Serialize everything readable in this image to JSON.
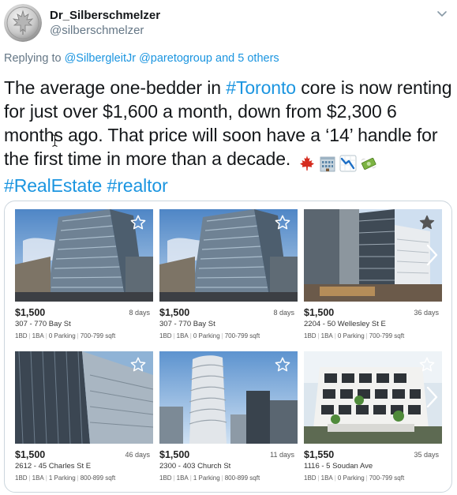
{
  "author": {
    "display_name": "Dr_Silberschmelzer",
    "handle": "@silberschmelzer"
  },
  "reply": {
    "prefix": "Replying to",
    "mentions": "@SilbergleitJr @paretogroup",
    "others": "and 5 others"
  },
  "tweet": {
    "text_1": "The average one-bedder in ",
    "hashtag_toronto": "#Toronto",
    "text_2": " core is now renting for just over $1,600 a month, down from $2,300 6 months ago. That price will soon have a ‘14’ handle for the first time in more than a decade. ",
    "hashtag_realestate": "#RealEstate",
    "hashtag_realtor": "#realtor",
    "emoji_icons": [
      "canada-flag-emoji",
      "office-building-emoji",
      "chart-decreasing-emoji",
      "money-with-wings-emoji"
    ]
  },
  "listings": [
    {
      "price": "$1,500",
      "days": "8 days",
      "address": "307 - 770 Bay St",
      "bd": "1BD",
      "ba": "1BA",
      "parking": "0 Parking",
      "sqft": "700-799 sqft"
    },
    {
      "price": "$1,500",
      "days": "8 days",
      "address": "307 - 770 Bay St",
      "bd": "1BD",
      "ba": "1BA",
      "parking": "0 Parking",
      "sqft": "700-799 sqft"
    },
    {
      "price": "$1,500",
      "days": "36 days",
      "address": "2204 - 50 Wellesley St E",
      "bd": "1BD",
      "ba": "1BA",
      "parking": "0 Parking",
      "sqft": "700-799 sqft"
    },
    {
      "price": "$1,500",
      "days": "46 days",
      "address": "2612 - 45 Charles St E",
      "bd": "1BD",
      "ba": "1BA",
      "parking": "1 Parking",
      "sqft": "800-899 sqft"
    },
    {
      "price": "$1,500",
      "days": "11 days",
      "address": "2300 - 403 Church St",
      "bd": "1BD",
      "ba": "1BA",
      "parking": "1 Parking",
      "sqft": "800-899 sqft"
    },
    {
      "price": "$1,550",
      "days": "35 days",
      "address": "1116 - 5 Soudan Ave",
      "bd": "1BD",
      "ba": "1BA",
      "parking": "0 Parking",
      "sqft": "700-799 sqft"
    }
  ],
  "colors": {
    "link": "#1b95e0",
    "muted": "#657786",
    "text": "#14171a",
    "border": "#ccd6dd"
  }
}
